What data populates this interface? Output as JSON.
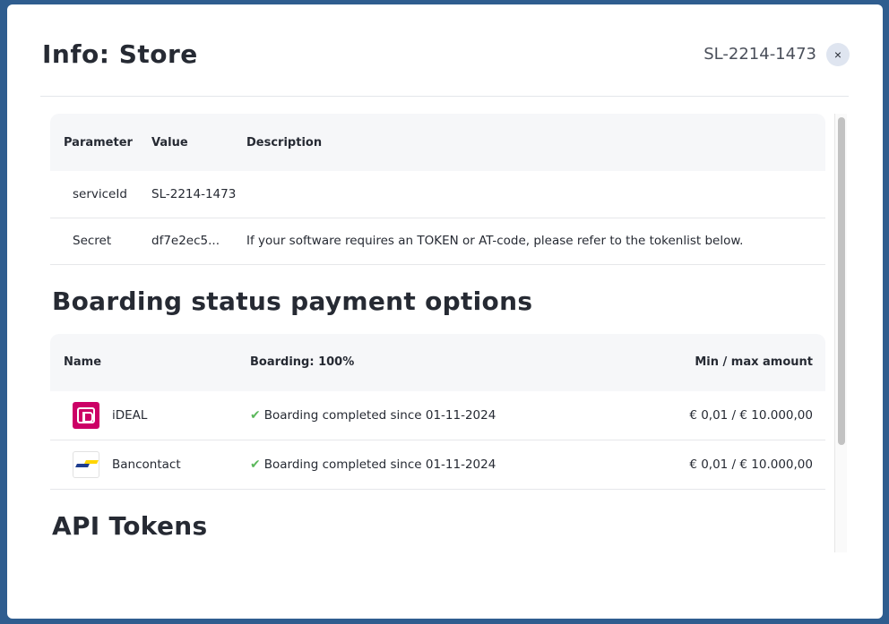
{
  "modal": {
    "title": "Info: Store",
    "service_id": "SL-2214-1473",
    "close_label": "×"
  },
  "params_table": {
    "headers": {
      "parameter": "Parameter",
      "value": "Value",
      "description": "Description"
    },
    "rows": [
      {
        "parameter": "serviceId",
        "value": "SL-2214-1473",
        "description": ""
      },
      {
        "parameter": "Secret",
        "value": "df7e2ec5...",
        "description": "If your software requires an TOKEN or AT-code, please refer to the tokenlist below."
      }
    ]
  },
  "boarding": {
    "heading": "Boarding status payment options",
    "headers": {
      "name": "Name",
      "boarding": "Boarding: 100%",
      "amount": "Min / max amount"
    },
    "rows": [
      {
        "name": "iDEAL",
        "logo": "ideal-logo",
        "status": "Boarding completed since 01-11-2024",
        "amount": "€ 0,01 / € 10.000,00"
      },
      {
        "name": "Bancontact",
        "logo": "bancontact-logo",
        "status": "Boarding completed since 01-11-2024",
        "amount": "€ 0,01 / € 10.000,00"
      }
    ]
  },
  "api_tokens": {
    "heading": "API Tokens"
  },
  "colors": {
    "backdrop": "#2f5d8f",
    "ideal": "#cc0066",
    "check": "#5cb85c"
  }
}
